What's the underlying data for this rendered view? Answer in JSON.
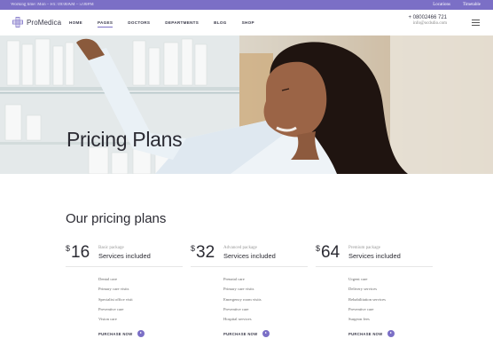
{
  "topbar": {
    "working_label": "Working time:",
    "working_value": "Mon – Fri: 09:00AM – 5:00PM",
    "links": [
      "Locations",
      "Timetable"
    ]
  },
  "header": {
    "logo_text": "ProMedica",
    "nav": [
      "HOME",
      "PAGES",
      "DOCTORS",
      "DEPARTMENTS",
      "BLOG",
      "SHOP"
    ],
    "active_nav": "PAGES",
    "phone": "+ 08002466 721",
    "email": "info@ocdsdio.com"
  },
  "hero": {
    "title": "Pricing Plans"
  },
  "pricing": {
    "title": "Our pricing plans",
    "plans": [
      {
        "currency": "$",
        "price": "16",
        "package": "Basic package",
        "included": "Services included",
        "items": [
          "Dental care",
          "Primary care visits",
          "Specialist office visit",
          "Preventive care",
          "Vision care"
        ],
        "button": "PURCHASE NOW"
      },
      {
        "currency": "$",
        "price": "32",
        "package": "Advanced package",
        "included": "Services included",
        "items": [
          "Prenatal care",
          "Primary care visits",
          "Emergency room visits",
          "Preventive care",
          "Hospital services"
        ],
        "button": "PURCHASE NOW"
      },
      {
        "currency": "$",
        "price": "64",
        "package": "Premium package",
        "included": "Services included",
        "items": [
          "Urgent care",
          "Delivery services",
          "Rehabilitation services",
          "Preventive care",
          "Surgeon fees"
        ],
        "button": "PURCHASE NOW"
      }
    ]
  },
  "colors": {
    "accent": "#7b6fc6",
    "text_dark": "#2b2b33"
  }
}
